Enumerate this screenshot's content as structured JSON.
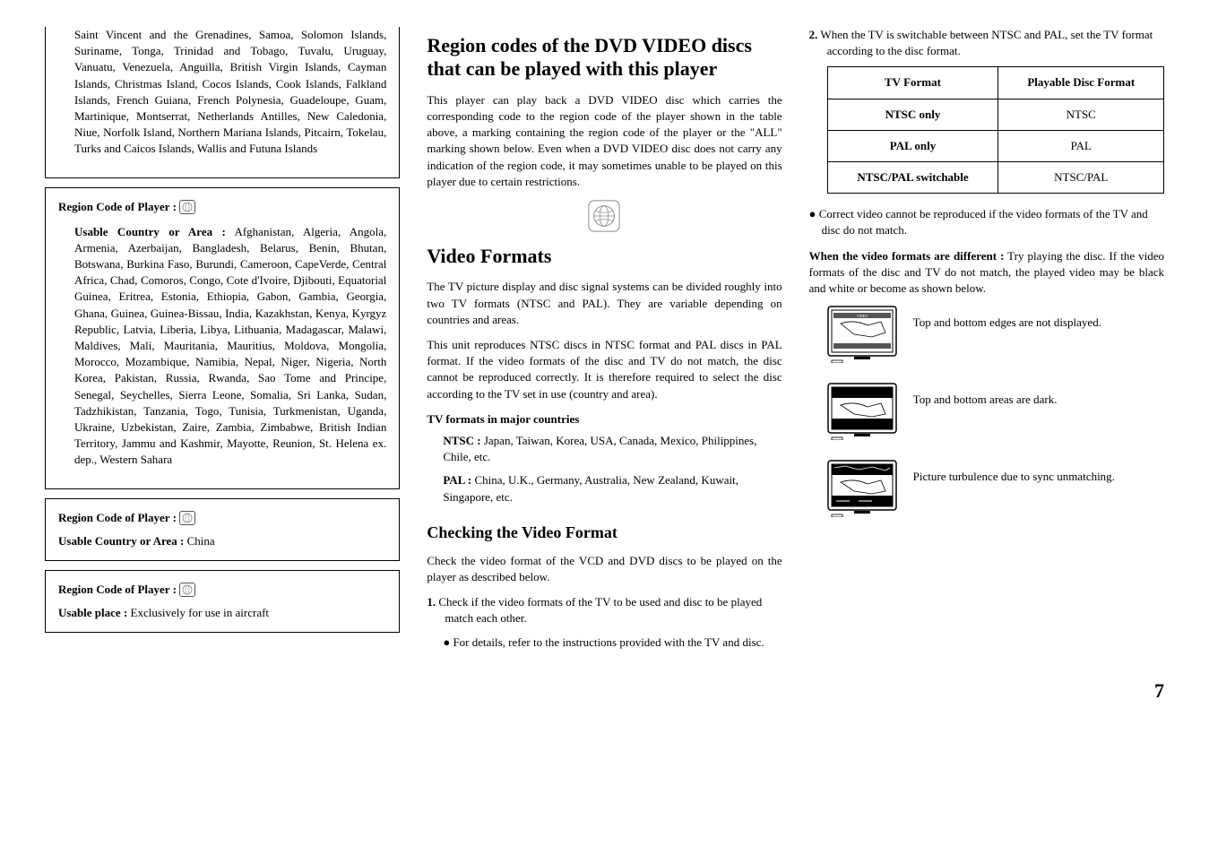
{
  "col1": {
    "box1_countries": "Saint Vincent and the Grenadines, Samoa, Solomon Islands, Suriname, Tonga, Trinidad and Tobago, Tuvalu, Uruguay, Vanuatu, Venezuela, Anguilla, British Virgin Islands, Cayman Islands, Christmas Island, Cocos Islands, Cook Islands, Falkland Islands, French Guiana, French Polynesia, Guadeloupe, Guam, Martinique, Montserrat, Netherlands Antilles, New Caledonia, Niue, Norfolk Island, Northern Mariana Islands, Pitcairn, Tokelau, Turks and Caicos Islands, Wallis and Futuna Islands",
    "region_label": "Region Code of Player :",
    "usable_label": "Usable Country or Area :",
    "box2_countries": "Afghanistan, Algeria, Angola, Armenia, Azerbaijan, Bangladesh, Belarus, Benin, Bhutan, Botswana, Burkina Faso, Burundi, Cameroon, CapeVerde, Central Africa, Chad, Comoros, Congo, Cote d'Ivoire, Djibouti, Equatorial Guinea, Eritrea, Estonia, Ethiopia, Gabon, Gambia, Georgia, Ghana, Guinea, Guinea-Bissau, India, Kazakhstan, Kenya, Kyrgyz Republic, Latvia, Liberia, Libya, Lithuania, Madagascar, Malawi, Maldives, Mali, Mauritania, Mauritius, Moldova, Mongolia, Morocco, Mozambique, Namibia, Nepal, Niger, Nigeria, North Korea, Pakistan, Russia, Rwanda, Sao Tome and Principe, Senegal, Seychelles, Sierra Leone, Somalia, Sri Lanka, Sudan, Tadzhikistan, Tanzania, Togo, Tunisia, Turkmenistan, Uganda, Ukraine, Uzbekistan, Zaire, Zambia, Zimbabwe, British Indian Territory, Jammu and Kashmir, Mayotte, Reunion, St. Helena ex. dep., Western Sahara",
    "box3_value": "China",
    "box4_label": "Usable place :",
    "box4_value": "Exclusively for use in aircraft"
  },
  "col2": {
    "h_region": "Region codes of the DVD VIDEO discs that can be played with this player",
    "p_region": "This player can play back a DVD VIDEO disc which carries the corresponding code to the region code of the player shown in the table above, a marking containing the region code of the player or the \"ALL\" marking shown below. Even when a DVD VIDEO disc does not carry any indication of the region code, it may sometimes unable to be played on this player due to certain restrictions.",
    "h_video": "Video Formats",
    "p_video1": "The TV picture display and disc signal systems can be divided roughly into two TV formats (NTSC and PAL). They are variable depending on countries and areas.",
    "p_video2": "This unit reproduces NTSC discs in NTSC format and PAL discs in PAL format. If the video formats of the disc and TV do not match, the disc cannot be reproduced correctly. It is therefore required to select the disc according to the TV set in use (country and area).",
    "sub_tv": "TV formats in major countries",
    "ntsc_label": "NTSC :",
    "ntsc_text": "Japan, Taiwan, Korea, USA, Canada, Mexico, Philippines, Chile, etc.",
    "pal_label": "PAL :",
    "pal_text": "China, U.K., Germany, Australia, New Zealand, Kuwait, Singapore, etc.",
    "h_check": "Checking the Video Format",
    "p_check": "Check the video format of the VCD and DVD discs to be played on the player as described below.",
    "step1_num": "1.",
    "step1": "Check if the video formats of the TV to be used and disc to be played match each other.",
    "step1_b": "For details, refer to the instructions provided with the TV and disc."
  },
  "col3": {
    "step2_num": "2.",
    "step2": "When the TV is switchable between NTSC and PAL, set the TV format according to the disc format.",
    "table": {
      "h1": "TV Format",
      "h2": "Playable Disc Format",
      "r1c1": "NTSC only",
      "r1c2": "NTSC",
      "r2c1": "PAL only",
      "r2c2": "PAL",
      "r3c1": "NTSC/PAL switchable",
      "r3c2": "NTSC/PAL"
    },
    "bullet_correct": "Correct video cannot be reproduced if the video formats of the TV and disc do not match.",
    "when_label": "When the video formats are different :",
    "when_text": "Try playing the disc. If the video formats of the disc and TV do not match, the played video may be black and white or become as shown below.",
    "cap1": "Top and bottom edges are not displayed.",
    "cap2": "Top and bottom areas are dark.",
    "cap3": "Picture turbulence due to sync unmatching."
  },
  "page_num": "7"
}
